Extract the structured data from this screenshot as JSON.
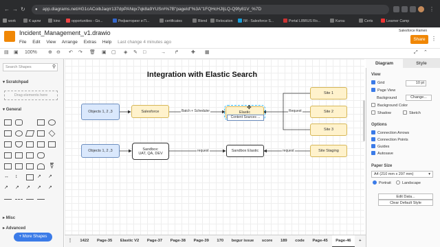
{
  "browser": {
    "url": "app.diagrams.net/#G1cACoibJaqrr137dpPANqx7qk8a9YUSr#%7B\"pageId\"%3A\"1FQHcHJIjLQ-Q9fy81V_%7D",
    "bookmarks": [
      "work",
      "К щели",
      "kino",
      "opportunities - Go...",
      "Рефакторинг и П...",
      "certificates",
      "Blend",
      "Relocation",
      "IM - Salesforce S...",
      "Portal LIBRUS Ro...",
      "Kursu",
      "Certs",
      "Learner Camp"
    ]
  },
  "app": {
    "file_title": "Incident_Management_v1.drawio",
    "menu": [
      "File",
      "Edit",
      "View",
      "Arrange",
      "Extras",
      "Help"
    ],
    "last_change": "Last change 4 minutes ago",
    "user": "Salesforce Ramen",
    "share_label": "Share",
    "zoom": "100%"
  },
  "left_panel": {
    "search_placeholder": "Search Shapes",
    "scratchpad": "Scratchpad",
    "drag_hint": "Drag elements here",
    "general": "General",
    "misc": "Misc",
    "advanced": "Advanced",
    "more_shapes": "+ More Shapes"
  },
  "diagram": {
    "title": "Integration with Elastic Search",
    "nodes": {
      "objects1": "Objects 1, 2 ,3",
      "salesforce": "Salesforce",
      "elastic": "Elastic",
      "content_sources": "Content Sources ...",
      "site1": "Site 1",
      "site2": "Site 2",
      "site3": "Site 3",
      "objects2": "Objects 1, 2 ,3",
      "sandbox": "Sandbox:\nUAT, QA, DEV",
      "sandbox_elastic": "Sandbox Elastic",
      "site_staging": "Site Staging"
    },
    "edges": {
      "batch": "Batch + Scheduler",
      "request1": "Request",
      "request2": "request",
      "request3": "request"
    }
  },
  "right_panel": {
    "tabs": [
      "Diagram",
      "Style"
    ],
    "view": "View",
    "grid": "Grid",
    "grid_size": "10 pt",
    "page_view": "Page View",
    "background": "Background",
    "change": "Change...",
    "background_color": "Background Color",
    "shadow": "Shadow",
    "sketch": "Sketch",
    "options": "Options",
    "connection_arrows": "Connection Arrows",
    "connection_points": "Connection Points",
    "guides": "Guides",
    "autosave": "Autosave",
    "paper_size": "Paper Size",
    "paper_value": "A4 (210 mm x 297 mm)",
    "portrait": "Portrait",
    "landscape": "Landscape",
    "edit_data": "Edit Data...",
    "clear_style": "Clear Default Style"
  },
  "page_tabs": [
    "1422",
    "Page-35",
    "Elastic V2",
    "Page-37",
    "Page-38",
    "Page-39",
    "170",
    "begur issue",
    "score",
    "189",
    "code",
    "Page-45",
    "Page-46"
  ],
  "active_tab": "Page-46"
}
